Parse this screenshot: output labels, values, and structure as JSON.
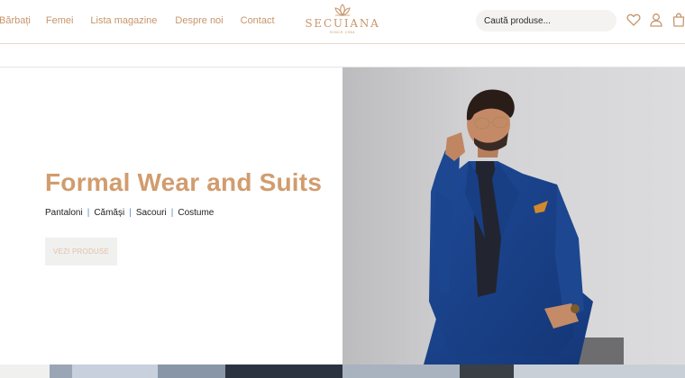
{
  "nav": {
    "items": [
      "Bărbați",
      "Femei",
      "Lista magazine",
      "Despre noi",
      "Contact"
    ]
  },
  "logo": {
    "name": "SECUIANA",
    "since": "SINCE 1964"
  },
  "search": {
    "placeholder": "Caută produse..."
  },
  "icons": {
    "wishlist": "heart-icon",
    "account": "user-icon",
    "cart": "bag-icon"
  },
  "hero": {
    "title": "Formal Wear and Suits",
    "categories": [
      "Pantaloni",
      "Cămăși",
      "Sacouri",
      "Costume"
    ],
    "separator": "|",
    "cta_label": "VEZI PRODUSE"
  },
  "colors": {
    "brand": "#c8956a",
    "title": "#d19c6e",
    "separator": "#5b88c2",
    "cta_bg": "#f0f0ef"
  }
}
